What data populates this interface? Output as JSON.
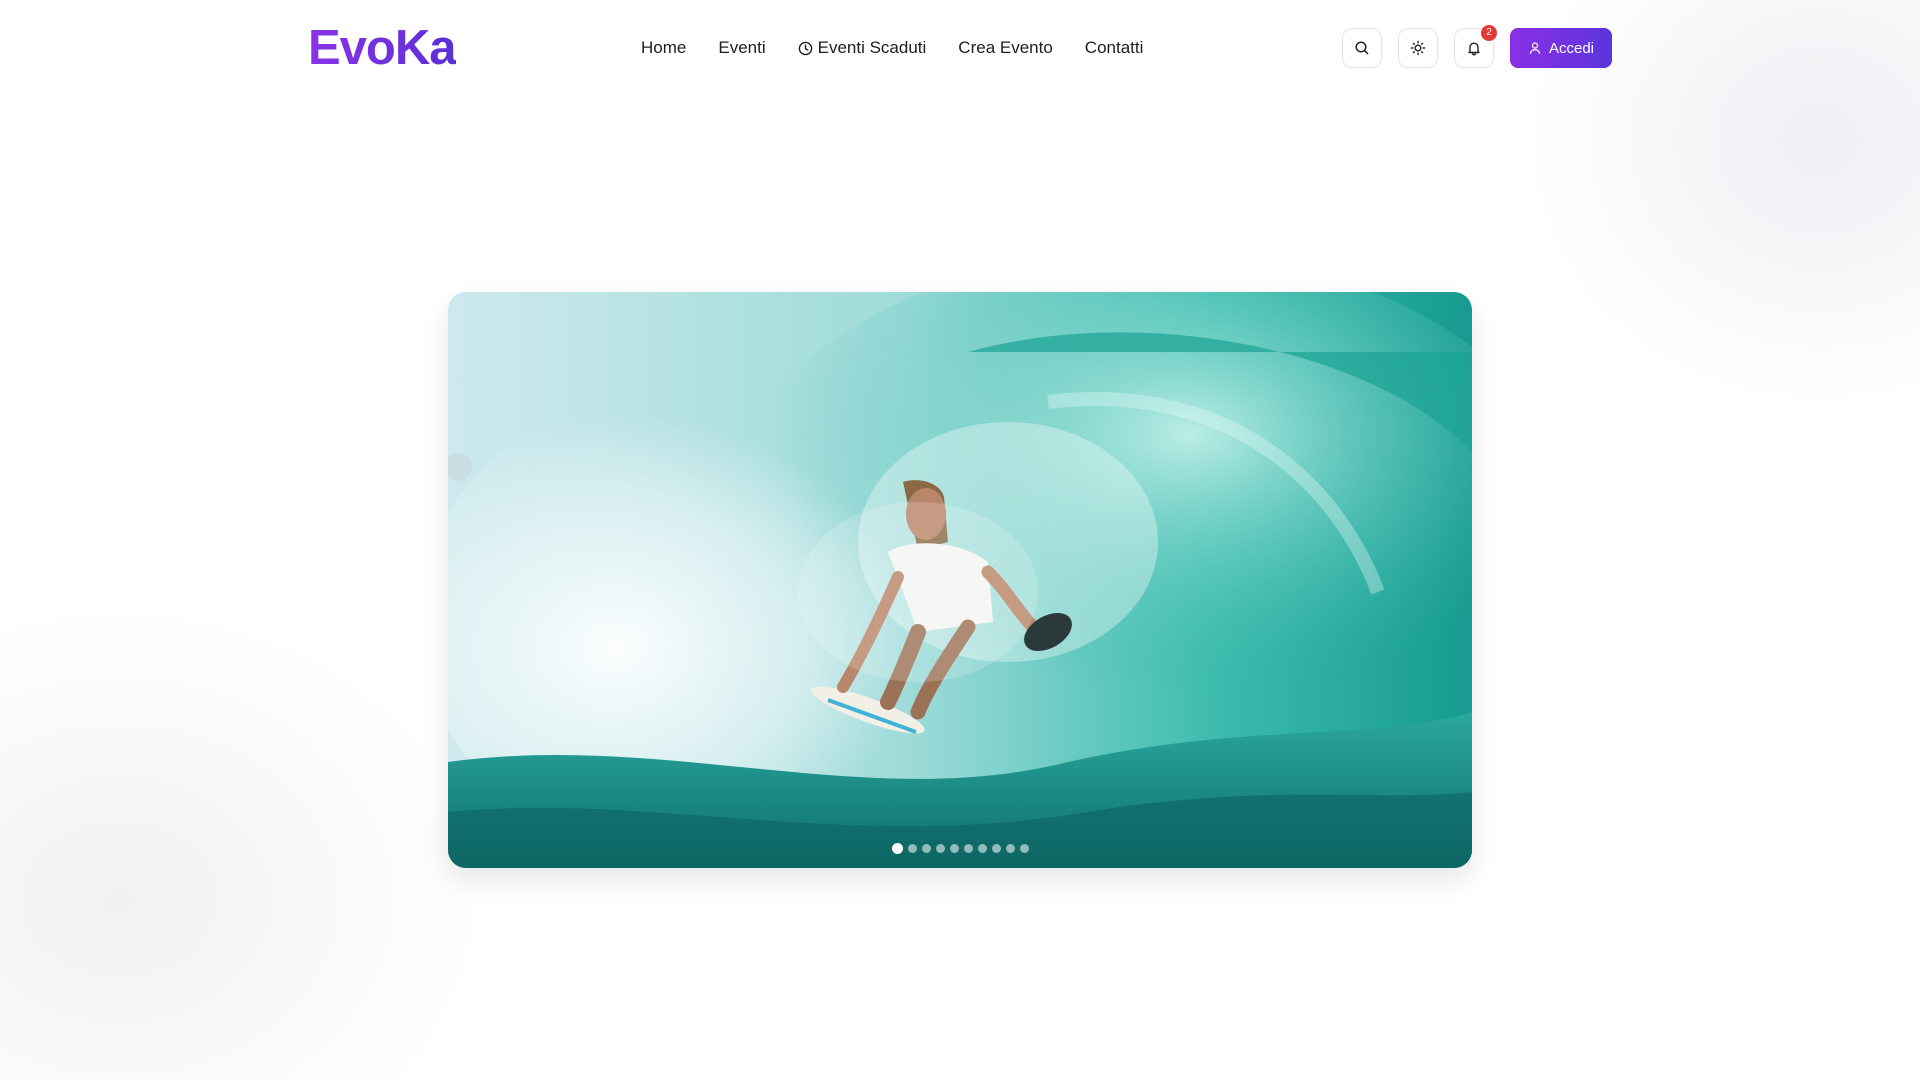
{
  "brand": {
    "name": "EvoKa"
  },
  "nav": [
    {
      "label": "Home"
    },
    {
      "label": "Eventi"
    },
    {
      "label": "Eventi Scaduti",
      "icon": "clock-icon"
    },
    {
      "label": "Crea Evento"
    },
    {
      "label": "Contatti"
    }
  ],
  "actions": {
    "search_icon": "search-icon",
    "theme_icon": "sun-icon",
    "bell_icon": "bell-icon",
    "notification_count": "2",
    "login_label": "Accedi",
    "login_icon": "user-icon"
  },
  "carousel": {
    "image": "surfer riding inside a turquoise wave",
    "slide_count": 10,
    "active_slide": 1
  },
  "colors": {
    "brand_gradient_start": "#8a32e6",
    "brand_gradient_end": "#5a30d6",
    "badge": "#e53935",
    "wave": "#2fb7a8"
  }
}
